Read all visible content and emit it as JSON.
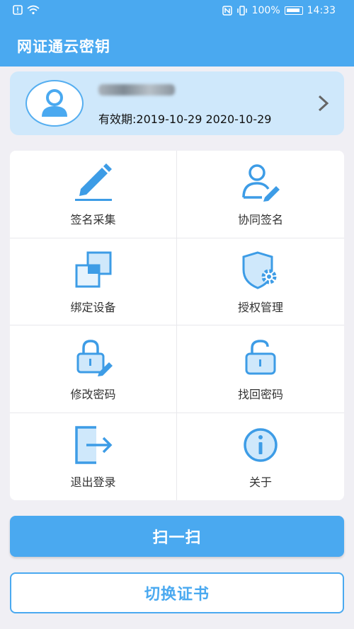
{
  "status_bar": {
    "battery_percent": "100%",
    "time": "14:33",
    "icons": [
      "alert-icon",
      "wifi-icon",
      "nfc-icon",
      "vibrate-icon",
      "battery-icon"
    ]
  },
  "app": {
    "title": "网证通云密钥"
  },
  "profile": {
    "username_hidden": "blurred",
    "validity": "有效期:2019-10-29 2020-10-29"
  },
  "menu": {
    "items": [
      {
        "label": "签名采集",
        "icon": "pen-icon"
      },
      {
        "label": "协同签名",
        "icon": "user-edit-icon"
      },
      {
        "label": "绑定设备",
        "icon": "devices-icon"
      },
      {
        "label": "授权管理",
        "icon": "shield-gear-icon"
      },
      {
        "label": "修改密码",
        "icon": "lock-edit-icon"
      },
      {
        "label": "找回密码",
        "icon": "unlock-icon"
      },
      {
        "label": "退出登录",
        "icon": "exit-icon"
      },
      {
        "label": "关于",
        "icon": "info-icon"
      }
    ]
  },
  "buttons": {
    "scan": "扫一扫",
    "switch_cert": "切换证书"
  },
  "colors": {
    "primary": "#4aa9f0",
    "card": "#cfe8fb",
    "icon": "#3d9ce6",
    "background": "#f0eff4"
  }
}
